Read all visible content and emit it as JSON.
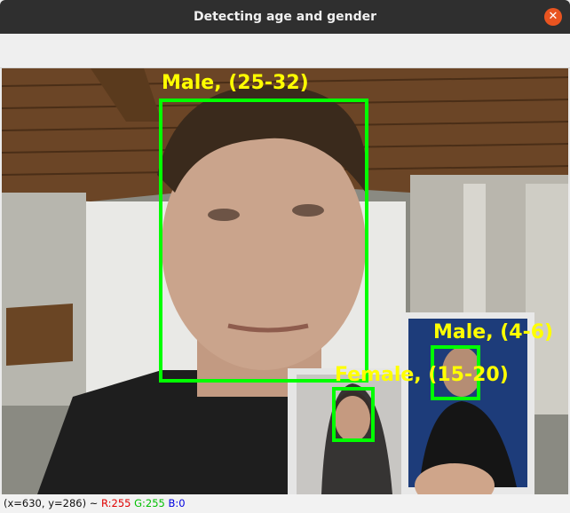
{
  "window": {
    "title": "Detecting age and gender"
  },
  "detections": [
    {
      "label": "Male, (25-32)"
    },
    {
      "label": "Male, (4-6)"
    },
    {
      "label": "Female, (15-20)"
    }
  ],
  "status": {
    "coords": "(x=630, y=286) ~",
    "r": "R:255",
    "g": "G:255",
    "b": "B:0"
  },
  "colors": {
    "box": "#00ff00",
    "label": "#ffff00",
    "titlebar": "#2f2f2f",
    "close": "#e95420"
  }
}
